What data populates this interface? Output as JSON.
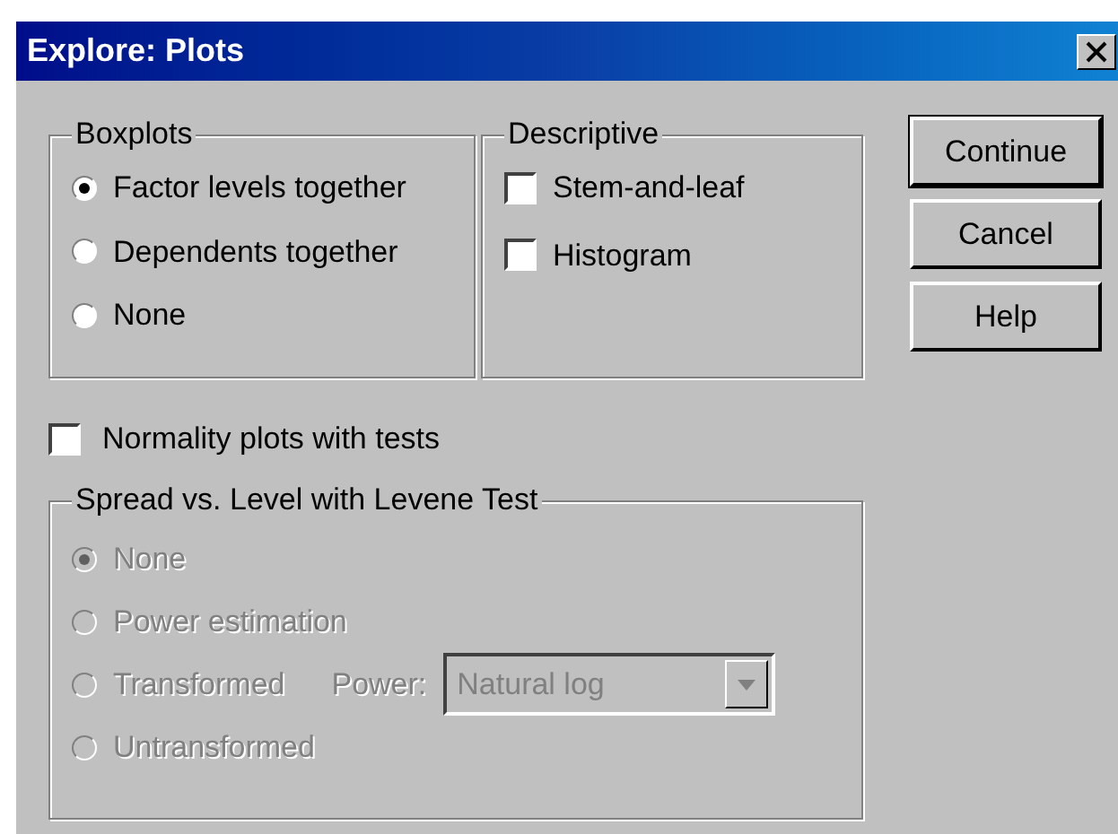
{
  "window": {
    "title": "Explore: Plots"
  },
  "boxplots": {
    "label": "Boxplots",
    "options": [
      {
        "label": "Factor levels together",
        "selected": true
      },
      {
        "label": "Dependents together",
        "selected": false
      },
      {
        "label": "None",
        "selected": false
      }
    ]
  },
  "descriptive": {
    "label": "Descriptive",
    "items": [
      {
        "label": "Stem-and-leaf",
        "checked": false
      },
      {
        "label": "Histogram",
        "checked": false
      }
    ]
  },
  "buttons": [
    {
      "label": "Continue",
      "default": true
    },
    {
      "label": "Cancel",
      "default": false
    },
    {
      "label": "Help",
      "default": false
    }
  ],
  "normality": {
    "label": "Normality plots with tests",
    "checked": false
  },
  "spread": {
    "label": "Spread vs. Level with Levene Test",
    "disabled": true,
    "options": [
      {
        "label": "None",
        "selected": true
      },
      {
        "label": "Power estimation",
        "selected": false
      },
      {
        "label": "Transformed",
        "selected": false,
        "power": {
          "label": "Power:",
          "value": "Natural log"
        }
      },
      {
        "label": "Untransformed",
        "selected": false
      }
    ]
  }
}
